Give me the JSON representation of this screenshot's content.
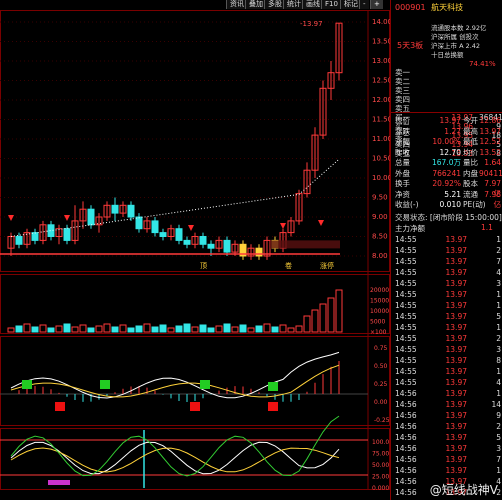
{
  "toolbar": {
    "buttons": [
      "资讯",
      "叠加",
      "多股",
      "统计",
      "画线",
      "F10",
      "标记",
      "-",
      "+"
    ],
    "active_index": 8
  },
  "chart_labels": {
    "top_marker": "-13.97",
    "annotations": [
      "顶",
      "卷",
      "涨停"
    ]
  },
  "price_axis": {
    "ticks": [
      "14.00",
      "13.50",
      "13.00",
      "12.50",
      "12.00",
      "11.50",
      "11.00",
      "10.50",
      "10.00",
      "9.50",
      "9.00",
      "8.50",
      "8.00"
    ]
  },
  "volume_axis": {
    "ticks": [
      "20000",
      "15000",
      "10000",
      "5000",
      "×100"
    ]
  },
  "macd_axis": {
    "ticks": [
      "0.75",
      "0.50",
      "0.25",
      "0.00",
      "-0.25"
    ]
  },
  "kdj_axis": {
    "ticks": [
      "100.0",
      "75.00",
      "50.00",
      "25.00",
      "0.000"
    ]
  },
  "stock": {
    "code": "000901",
    "name": "航天科技",
    "info_lines": [
      "流通股本数 2.92亿",
      "沪深所属 创投次",
      "沪深上市 A 2.42",
      "十日总换额"
    ],
    "tag": "5天3板",
    "percent": "74.41%"
  },
  "orderbook": [
    {
      "label": "卖一",
      "price": "",
      "vol": ""
    },
    {
      "label": "卖二",
      "price": "",
      "vol": ""
    },
    {
      "label": "卖三",
      "price": "",
      "vol": ""
    },
    {
      "label": "卖四",
      "price": "",
      "vol": ""
    },
    {
      "label": "卖五",
      "price": "",
      "vol": ""
    },
    {
      "label": "买一",
      "price": "13.97",
      "vol": "36841"
    },
    {
      "label": "买二",
      "price": "13.96",
      "vol": "9"
    },
    {
      "label": "买三",
      "price": "13.95",
      "vol": "18"
    },
    {
      "label": "买四",
      "price": "13.94",
      "vol": "5"
    },
    {
      "label": "买五",
      "price": "13.93",
      "vol": "8"
    }
  ],
  "quote": [
    {
      "l1": "现价",
      "v1": "13.97",
      "l2": "今开",
      "v2": "12.86"
    },
    {
      "l1": "涨跌",
      "v1": "1.27",
      "l2": "最高",
      "v2": "13.97"
    },
    {
      "l1": "涨幅",
      "v1": "10.00%",
      "l2": "最低",
      "v2": "12.52"
    },
    {
      "l1": "昨收",
      "v1": "12.70",
      "l2": "均价",
      "v2": "13.52"
    },
    {
      "l1": "总量",
      "v1": "167.0万",
      "l2": "量比",
      "v2": "1.64"
    },
    {
      "l1": "外盘",
      "v1": "766241",
      "l2": "内盘",
      "v2": "904111"
    },
    {
      "l1": "换手",
      "v1": "20.92%",
      "l2": "股本",
      "v2": "7.97亿"
    },
    {
      "l1": "净资",
      "v1": "5.21",
      "l2": "流通",
      "v2": "7.98亿"
    },
    {
      "l1": "收益(-)",
      "v1": "0.010",
      "l2": "PE(动)",
      "v2": "-"
    }
  ],
  "trade_status": {
    "label": "交易状态",
    "value": "[闭市阶段 15:00:00]"
  },
  "main_force": {
    "label": "主力净额",
    "value": "1.1"
  },
  "trades": [
    {
      "time": "14:55",
      "price": "13.97",
      "vol": "1"
    },
    {
      "time": "14:55",
      "price": "13.97",
      "vol": "2"
    },
    {
      "time": "14:55",
      "price": "13.97",
      "vol": "7"
    },
    {
      "time": "14:55",
      "price": "13.97",
      "vol": "4"
    },
    {
      "time": "14:55",
      "price": "13.97",
      "vol": "3"
    },
    {
      "time": "14:55",
      "price": "13.97",
      "vol": "1"
    },
    {
      "time": "14:55",
      "price": "13.97",
      "vol": "1"
    },
    {
      "time": "14:55",
      "price": "13.97",
      "vol": "5"
    },
    {
      "time": "14:55",
      "price": "13.97",
      "vol": "1"
    },
    {
      "time": "14:55",
      "price": "13.97",
      "vol": "2"
    },
    {
      "time": "14:55",
      "price": "13.97",
      "vol": "3"
    },
    {
      "time": "14:55",
      "price": "13.97",
      "vol": "8"
    },
    {
      "time": "14:55",
      "price": "13.97",
      "vol": "1"
    },
    {
      "time": "14:55",
      "price": "13.97",
      "vol": "4"
    },
    {
      "time": "14:56",
      "price": "13.97",
      "vol": "1"
    },
    {
      "time": "14:56",
      "price": "13.97",
      "vol": "14"
    },
    {
      "time": "14:56",
      "price": "13.97",
      "vol": "9"
    },
    {
      "time": "14:56",
      "price": "13.97",
      "vol": "2"
    },
    {
      "time": "14:56",
      "price": "13.97",
      "vol": "5"
    },
    {
      "time": "14:56",
      "price": "13.97",
      "vol": "3"
    },
    {
      "time": "14:56",
      "price": "13.97",
      "vol": "7"
    },
    {
      "time": "14:56",
      "price": "13.97",
      "vol": "1"
    },
    {
      "time": "14:56",
      "price": "13.97",
      "vol": "4"
    },
    {
      "time": "14:56",
      "price": "13.97",
      "vol": "2"
    }
  ],
  "watermark": "@短线战神V",
  "colors": {
    "up": "#ff3a3a",
    "down": "#33e6e6",
    "bg": "#000000",
    "ma": "#ffffff",
    "signal": "#ffd23a"
  }
}
